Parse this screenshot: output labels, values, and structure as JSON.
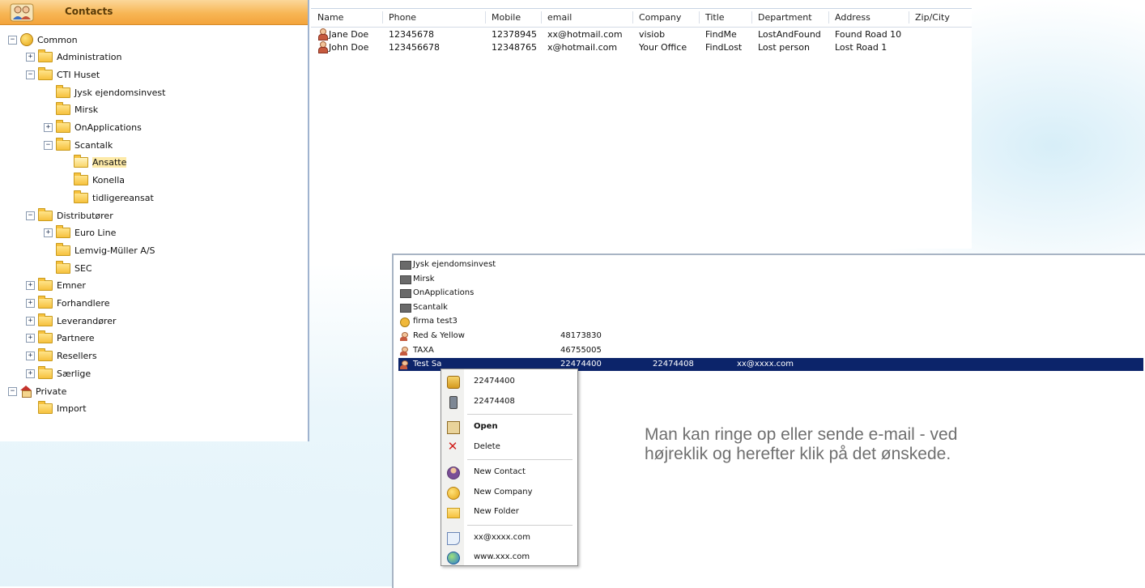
{
  "tree": {
    "header_title": "Contacts",
    "items": [
      {
        "label": "Common",
        "level": 0,
        "exp": "-",
        "icon": "globe"
      },
      {
        "label": "Administration",
        "level": 1,
        "exp": "+",
        "icon": "folder"
      },
      {
        "label": "CTI Huset",
        "level": 1,
        "exp": "-",
        "icon": "folder"
      },
      {
        "label": "Jysk ejendomsinvest",
        "level": 2,
        "exp": "",
        "icon": "folder"
      },
      {
        "label": "Mirsk",
        "level": 2,
        "exp": "",
        "icon": "folder"
      },
      {
        "label": "OnApplications",
        "level": 2,
        "exp": "+",
        "icon": "folder"
      },
      {
        "label": "Scantalk",
        "level": 2,
        "exp": "-",
        "icon": "folder"
      },
      {
        "label": "Ansatte",
        "level": 3,
        "exp": "",
        "icon": "folder-open",
        "selected": true
      },
      {
        "label": "Konella",
        "level": 3,
        "exp": "",
        "icon": "folder"
      },
      {
        "label": "tidligereansat",
        "level": 3,
        "exp": "",
        "icon": "folder"
      },
      {
        "label": "Distributører",
        "level": 1,
        "exp": "-",
        "icon": "folder"
      },
      {
        "label": "Euro Line",
        "level": 2,
        "exp": "+",
        "icon": "folder"
      },
      {
        "label": "Lemvig-Müller A/S",
        "level": 2,
        "exp": "",
        "icon": "folder"
      },
      {
        "label": "SEC",
        "level": 2,
        "exp": "",
        "icon": "folder"
      },
      {
        "label": "Emner",
        "level": 1,
        "exp": "+",
        "icon": "folder"
      },
      {
        "label": "Forhandlere",
        "level": 1,
        "exp": "+",
        "icon": "folder"
      },
      {
        "label": "Leverandører",
        "level": 1,
        "exp": "+",
        "icon": "folder"
      },
      {
        "label": "Partnere",
        "level": 1,
        "exp": "+",
        "icon": "folder"
      },
      {
        "label": "Resellers",
        "level": 1,
        "exp": "+",
        "icon": "folder"
      },
      {
        "label": "Særlige",
        "level": 1,
        "exp": "+",
        "icon": "folder"
      },
      {
        "label": "Private",
        "level": 0,
        "exp": "-",
        "icon": "house"
      },
      {
        "label": "Import",
        "level": 1,
        "exp": "",
        "icon": "folder"
      }
    ]
  },
  "grid": {
    "columns": [
      "Name",
      "Phone",
      "Mobile",
      "email",
      "Company",
      "Title",
      "Department",
      "Address",
      "Zip/City"
    ],
    "rows": [
      [
        "Jane Doe",
        "12345678",
        "12378945",
        "xx@hotmail.com",
        "visiob",
        "FindMe",
        "LostAndFound",
        "Found Road 10",
        ""
      ],
      [
        "John Doe",
        "123456678",
        "12348765",
        "x@hotmail.com",
        "Your Office",
        "FindLost",
        "Lost person",
        "Lost Road 1",
        ""
      ]
    ]
  },
  "list_window": {
    "rows": [
      {
        "icon": "folder",
        "name": "Jysk ejendomsinvest",
        "phone": "",
        "mobile": "",
        "email": ""
      },
      {
        "icon": "folder",
        "name": "Mirsk",
        "phone": "",
        "mobile": "",
        "email": ""
      },
      {
        "icon": "folder",
        "name": "OnApplications",
        "phone": "",
        "mobile": "",
        "email": ""
      },
      {
        "icon": "folder",
        "name": "Scantalk",
        "phone": "",
        "mobile": "",
        "email": ""
      },
      {
        "icon": "company",
        "name": "firma test3",
        "phone": "",
        "mobile": "",
        "email": ""
      },
      {
        "icon": "person",
        "name": "Red & Yellow",
        "phone": "48173830",
        "mobile": "",
        "email": ""
      },
      {
        "icon": "person",
        "name": "TAXA",
        "phone": "46755005",
        "mobile": "",
        "email": ""
      },
      {
        "icon": "person",
        "name": "Test Sa",
        "phone": "22474400",
        "mobile": "22474408",
        "email": "xx@xxxx.com",
        "selected": true
      }
    ]
  },
  "context_menu": {
    "items": [
      {
        "label": "22474400",
        "icon": "phone-icon",
        "kind": "phone"
      },
      {
        "label": "22474408",
        "icon": "mobile-icon",
        "kind": "mobile"
      },
      {
        "sep": true
      },
      {
        "label": "Open",
        "icon": "open-icon",
        "kind": "open",
        "bold": true
      },
      {
        "label": "Delete",
        "icon": "delete-icon",
        "kind": "delete"
      },
      {
        "sep": true
      },
      {
        "label": "New Contact",
        "icon": "new-contact-icon",
        "kind": "contact"
      },
      {
        "label": "New Company",
        "icon": "new-company-icon",
        "kind": "company"
      },
      {
        "label": "New Folder",
        "icon": "new-folder-icon",
        "kind": "folder"
      },
      {
        "sep": true
      },
      {
        "label": "xx@xxxx.com",
        "icon": "email-icon",
        "kind": "mail"
      },
      {
        "label": "www.xxx.com",
        "icon": "web-icon",
        "kind": "web"
      }
    ]
  },
  "caption": "Man kan ringe op eller sende e-mail - ved højreklik og herefter klik på det ønskede."
}
